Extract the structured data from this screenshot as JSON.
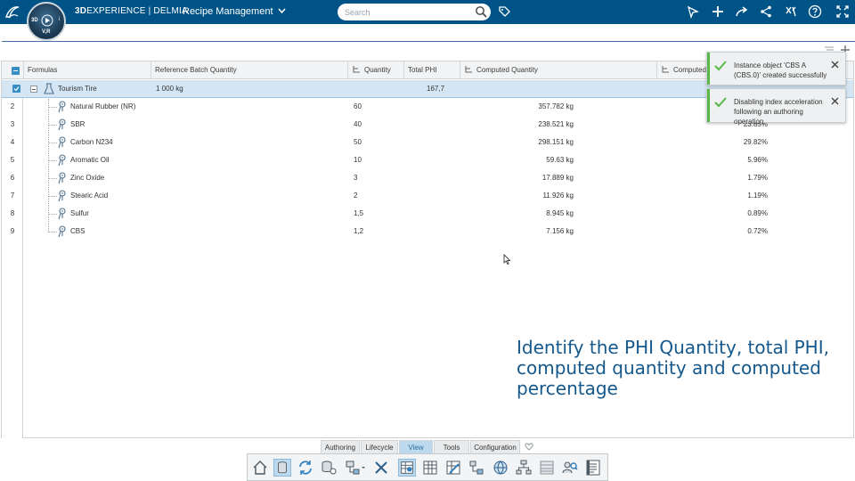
{
  "header": {
    "brand_bold": "3D",
    "brand_rest": "EXPERIENCE | DELMIA",
    "app_name": "Recipe Management",
    "search_placeholder": "Search",
    "compass_label": "V,R",
    "compass_3d": "3D",
    "compass_i": "i"
  },
  "table": {
    "columns": {
      "formulas": "Formulas",
      "reference_batch_quantity": "Reference Batch Quantity",
      "quantity": "Quantity",
      "total_phi": "Total PHI",
      "computed_quantity": "Computed Quantity",
      "computed_percentage": "Computed P"
    },
    "root": {
      "name": "Tourism Tire",
      "reference_batch_quantity": "1 000 kg",
      "total_phi": "167,7"
    },
    "rows": [
      {
        "num": "2",
        "name": "Natural Rubber (NR)",
        "quantity": "60",
        "computed_quantity": "357.782 kg",
        "computed_percentage": ""
      },
      {
        "num": "3",
        "name": "SBR",
        "quantity": "40",
        "computed_quantity": "238.521 kg",
        "computed_percentage": "23.85%"
      },
      {
        "num": "4",
        "name": "Carbon N234",
        "quantity": "50",
        "computed_quantity": "298.151 kg",
        "computed_percentage": "29.82%"
      },
      {
        "num": "5",
        "name": "Aromatic Oil",
        "quantity": "10",
        "computed_quantity": "59.63 kg",
        "computed_percentage": "5.96%"
      },
      {
        "num": "6",
        "name": "Zinc Oxide",
        "quantity": "3",
        "computed_quantity": "17.889 kg",
        "computed_percentage": "1.79%"
      },
      {
        "num": "7",
        "name": "Stearic Acid",
        "quantity": "2",
        "computed_quantity": "11.926 kg",
        "computed_percentage": "1.19%"
      },
      {
        "num": "8",
        "name": "Sulfur",
        "quantity": "1,5",
        "computed_quantity": "8.945 kg",
        "computed_percentage": "0.89%"
      },
      {
        "num": "9",
        "name": "CBS",
        "quantity": "1,2",
        "computed_quantity": "7.156 kg",
        "computed_percentage": "0.72%"
      }
    ]
  },
  "notifications": [
    {
      "text": "Instance object 'CBS A (CBS.0)' created successfully"
    },
    {
      "text": "Disabling index acceleration following an authoring operation"
    }
  ],
  "caption": "Identify the PHI Quantity, total PHI, computed quantity and computed percentage",
  "toolbar": {
    "tabs": [
      "Authoring",
      "Lifecycle",
      "View",
      "Tools",
      "Configuration"
    ],
    "active_tab": "View"
  },
  "colors": {
    "topbar": "#005386",
    "accent": "#368ec4",
    "root_row": "#d4e6f4",
    "success": "#57b847",
    "caption": "#15588c"
  }
}
